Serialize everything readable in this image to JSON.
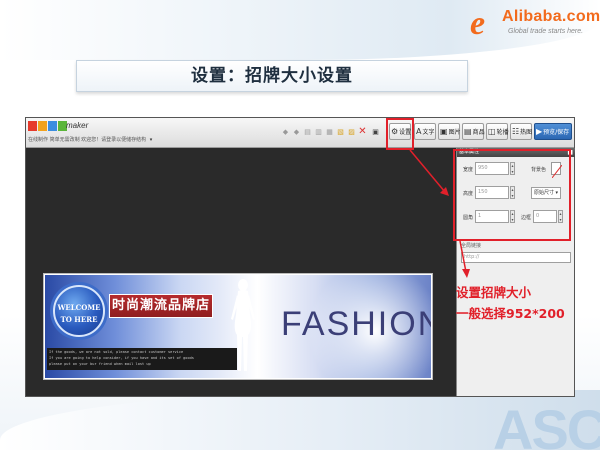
{
  "slide": {
    "title": "设置：招牌大小设置",
    "annotation": [
      "设置招牌大小",
      "一般选择952*200"
    ],
    "decor_text": "ASC"
  },
  "logo": {
    "mark": "e",
    "brand": "Alibaba.com",
    "tagline": "Global trade starts here."
  },
  "app": {
    "brand_word": "maker",
    "brand_colors": [
      "#e63a2b",
      "#f2a21d",
      "#3b8de0",
      "#5bb63a"
    ],
    "crumb": {
      "text": "在线制作 简单无需改制  欢迎您！请登录以便储存结构",
      "dropdown": "▾"
    },
    "toolbar": {
      "settings": "设置",
      "text": "文字",
      "image": "图片",
      "product": "商品",
      "carousel": "轮播",
      "hotspot": "热图",
      "save": "预览/保存"
    },
    "accent": "#2b67b3"
  },
  "banner": {
    "badge_line1": "WELCOME",
    "badge_line2": "TO HERE",
    "shop_name": "时尚潮流品牌店",
    "headline": "FASHION",
    "notice_lines": [
      "If the goods, we are not sold, please contact customer service",
      "If you are going to help consider, if you have and its set of goods",
      "please put on your bur friend when mail lost up"
    ]
  },
  "panel": {
    "title": "基本属性",
    "width_label": "宽度",
    "width_value": "950",
    "height_label": "高度",
    "height_value": "150",
    "radius_label": "圆角",
    "radius_value": "1",
    "bg_color_label": "背景色",
    "fit_select": "原始尺寸",
    "border_label": "边框",
    "border_value": "0",
    "link_label": "全局链接",
    "link_placeholder": "http://"
  },
  "highlight_color": "#e1202a"
}
